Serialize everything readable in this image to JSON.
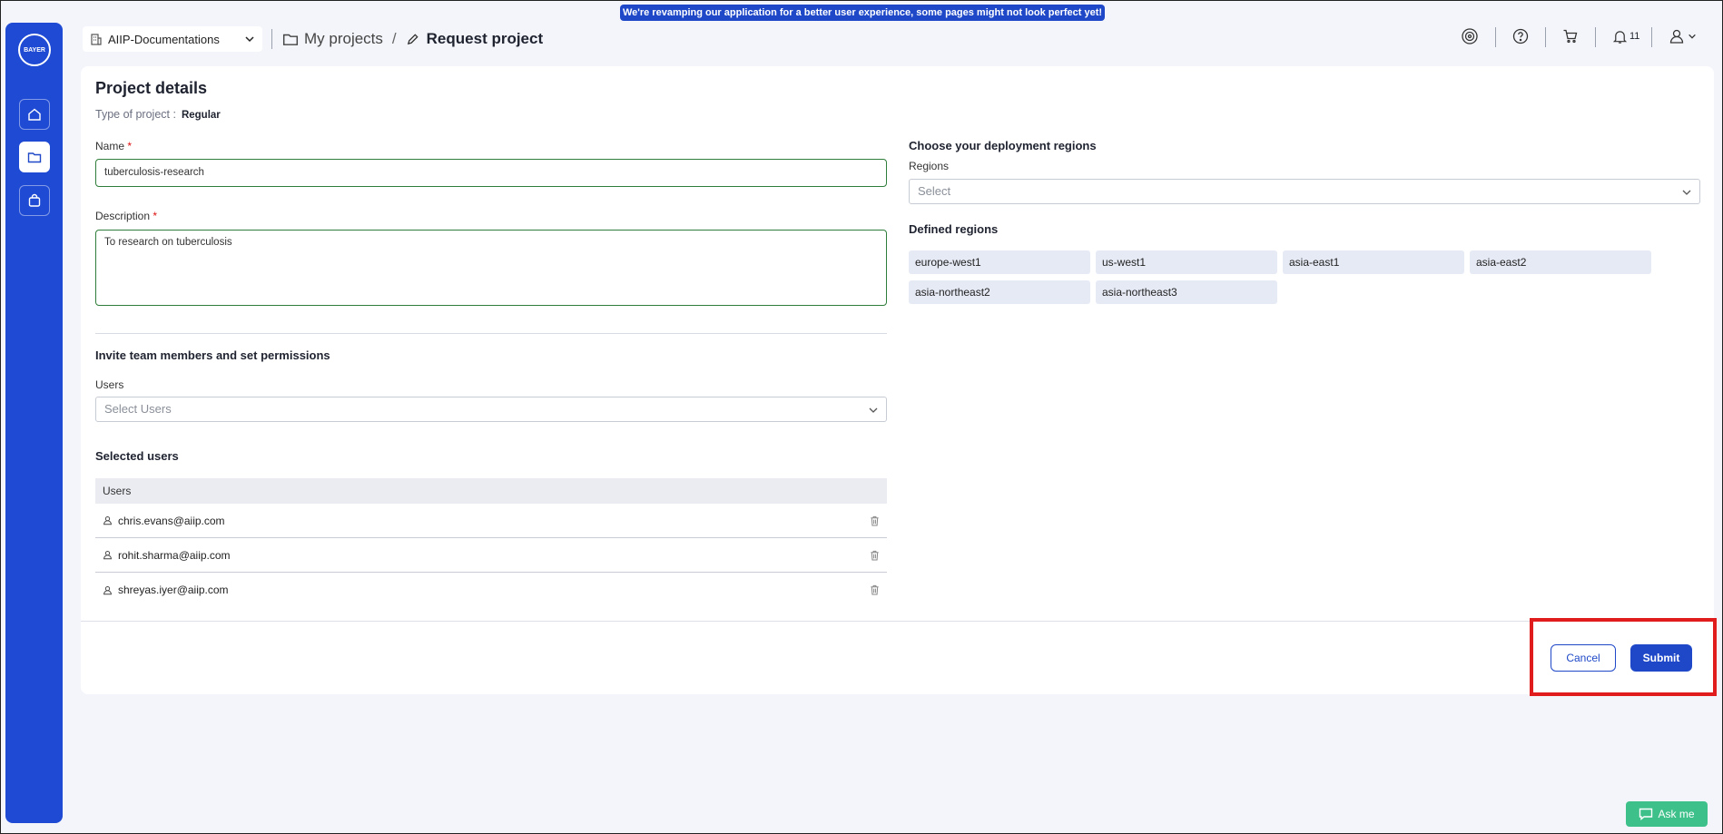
{
  "banner": "We're revamping our application for a better user experience, some pages might not look perfect yet!",
  "logo": "BAYER",
  "workspace": {
    "name": "AIIP-Documentations"
  },
  "breadcrumb": {
    "parent": "My projects",
    "separator": "/",
    "current": "Request project"
  },
  "header": {
    "notification_count": "11"
  },
  "form": {
    "title": "Project details",
    "type_label": "Type of project :",
    "type_value": "Regular",
    "name_label": "Name",
    "name_value": "tuberculosis-research",
    "required_mark": "*",
    "description_label": "Description",
    "description_value": "To research on tuberculosis",
    "invite_title": "Invite team members and set permissions",
    "users_label": "Users",
    "users_placeholder": "Select Users",
    "selected_title": "Selected users",
    "table_header": "Users",
    "users": [
      "chris.evans@aiip.com",
      "rohit.sharma@aiip.com",
      "shreyas.iyer@aiip.com"
    ]
  },
  "regions": {
    "title": "Choose your deployment regions",
    "label": "Regions",
    "placeholder": "Select",
    "defined_title": "Defined regions",
    "chips": [
      "europe-west1",
      "us-west1",
      "asia-east1",
      "asia-east2",
      "asia-northeast2",
      "asia-northeast3"
    ]
  },
  "actions": {
    "cancel": "Cancel",
    "submit": "Submit"
  },
  "assistant": {
    "label": "Ask me"
  },
  "colors": {
    "accent": "#1e48c8",
    "sidebar": "#1e4ad4",
    "highlight": "#e01c1c",
    "assistant": "#3ec08a"
  }
}
